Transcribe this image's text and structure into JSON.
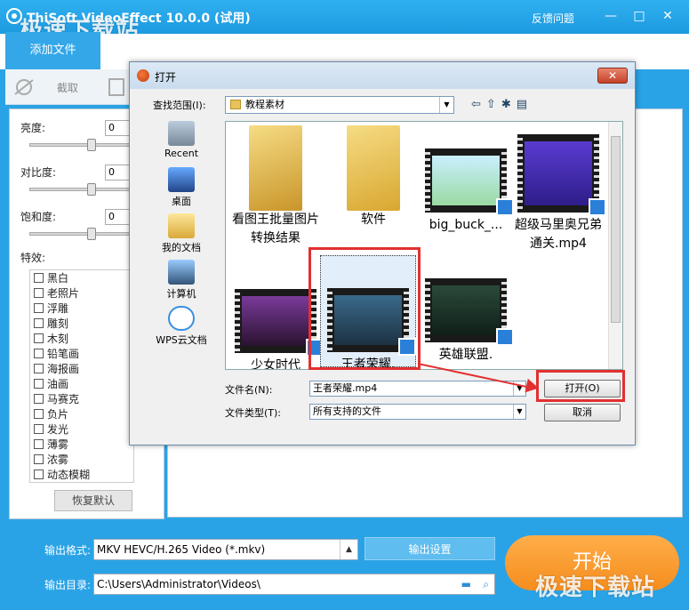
{
  "app": {
    "title": "ThiSoft VideoEffect 10.0.0 (试用)",
    "feedback": "反馈问题",
    "watermark": "极速下载站"
  },
  "tabs": {
    "add_file": "添加文件",
    "crop": "截取"
  },
  "adjust": {
    "brightness_label": "亮度:",
    "brightness_value": "0",
    "contrast_label": "对比度:",
    "contrast_value": "0",
    "saturation_label": "饱和度:",
    "saturation_value": "0",
    "effects_label": "特效:",
    "effects": [
      "黑白",
      "老照片",
      "浮雕",
      "雕刻",
      "木刻",
      "铅笔画",
      "海报画",
      "油画",
      "马赛克",
      "负片",
      "发光",
      "薄雾",
      "浓雾",
      "动态模糊"
    ],
    "restore_button": "恢复默认"
  },
  "bottom": {
    "format_label": "输出格式:",
    "format_value": "MKV HEVC/H.265 Video (*.mkv)",
    "output_settings": "输出设置",
    "dir_label": "输出目录:",
    "dir_value": "C:\\Users\\Administrator\\Videos\\",
    "start_button": "开始"
  },
  "dialog": {
    "title": "打开",
    "lookin_label": "查找范围(I):",
    "lookin_value": "教程素材",
    "places": [
      "Recent",
      "桌面",
      "我的文档",
      "计算机",
      "WPS云文档"
    ],
    "files": [
      {
        "name": "看图王批量图片转换结果",
        "kind": "folder"
      },
      {
        "name": "软件",
        "kind": "folder"
      },
      {
        "name": "big_buck_...",
        "kind": "video"
      },
      {
        "name": "超级马里奥兄弟通关.mp4",
        "kind": "video"
      },
      {
        "name": "少女时代",
        "kind": "video"
      },
      {
        "name": "王者荣耀.",
        "kind": "video"
      },
      {
        "name": "英雄联盟.",
        "kind": "video"
      }
    ],
    "filename_label": "文件名(N):",
    "filename_value": "王者荣耀.mp4",
    "filetype_label": "文件类型(T):",
    "filetype_value": "所有支持的文件",
    "open_button": "打开(O)",
    "cancel_button": "取消"
  }
}
